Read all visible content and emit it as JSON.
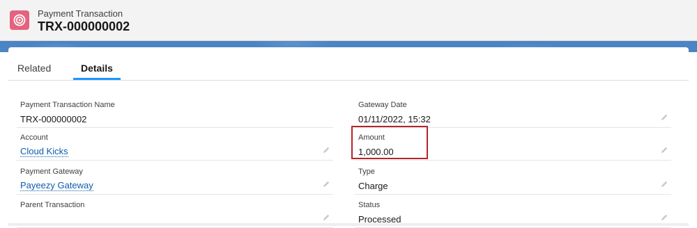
{
  "header": {
    "object_type": "Payment Transaction",
    "record_name": "TRX-000000002",
    "icon": "payment-transaction-icon",
    "icon_color": "#e4637f"
  },
  "banner_color": "#4b85c4",
  "tabs": [
    {
      "label": "Related",
      "active": false
    },
    {
      "label": "Details",
      "active": true
    }
  ],
  "fields": {
    "payment_transaction_name": {
      "label": "Payment Transaction Name",
      "value": "TRX-000000002"
    },
    "gateway_date": {
      "label": "Gateway Date",
      "value": "01/11/2022, 15:32"
    },
    "account": {
      "label": "Account",
      "value": "Cloud Kicks"
    },
    "amount": {
      "label": "Amount",
      "value": "1,000.00"
    },
    "payment_gateway": {
      "label": "Payment Gateway",
      "value": "Payeezy Gateway"
    },
    "type": {
      "label": "Type",
      "value": "Charge"
    },
    "parent_transaction": {
      "label": "Parent Transaction",
      "value": ""
    },
    "status": {
      "label": "Status",
      "value": "Processed"
    }
  },
  "colors": {
    "accent": "#1b96ff",
    "link": "#0b5cab",
    "highlight_border": "#b5242b"
  }
}
